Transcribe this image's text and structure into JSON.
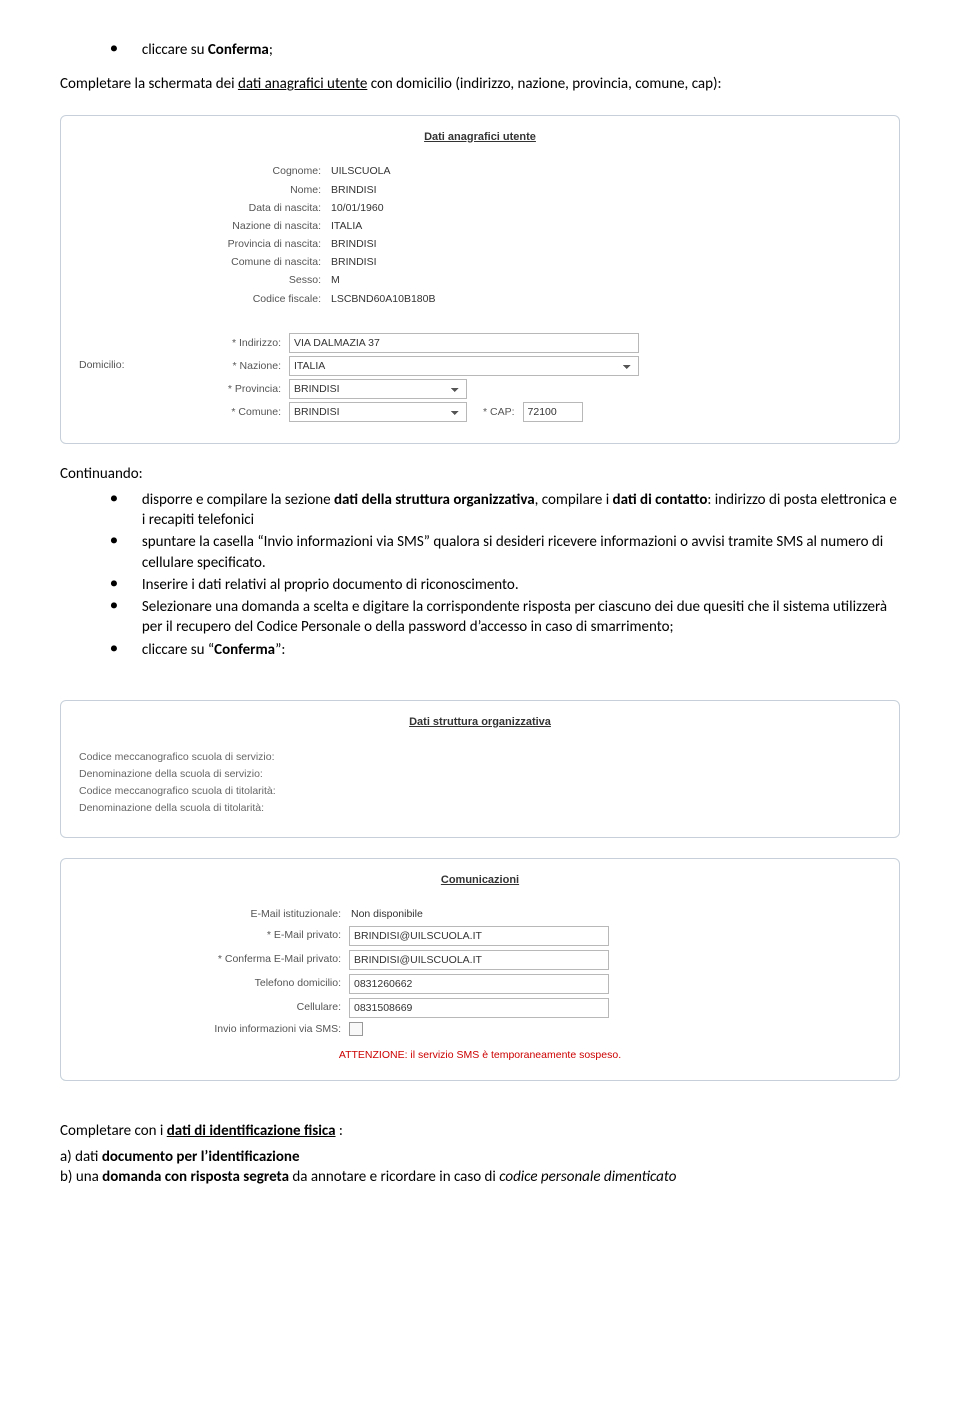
{
  "intro": {
    "bullet1_pre": "cliccare su ",
    "bullet1_bold": "Conferma",
    "bullet1_post": ";",
    "para_pre": "Completare la schermata dei ",
    "para_u": "dati anagrafici utente",
    "para_post": "  con domicilio (indirizzo, nazione, provincia, comune, cap):"
  },
  "panel1": {
    "title": "Dati anagrafici utente",
    "rows": {
      "cognome_l": "Cognome:",
      "cognome_v": "UILSCUOLA",
      "nome_l": "Nome:",
      "nome_v": "BRINDISI",
      "data_l": "Data di nascita:",
      "data_v": "10/01/1960",
      "naz_l": "Nazione di nascita:",
      "naz_v": "ITALIA",
      "prov_l": "Provincia di nascita:",
      "prov_v": "BRINDISI",
      "com_l": "Comune di nascita:",
      "com_v": "BRINDISI",
      "sesso_l": "Sesso:",
      "sesso_v": "M",
      "cf_l": "Codice fiscale:",
      "cf_v": "LSCBND60A10B180B"
    },
    "dom": {
      "side": "Domicilio:",
      "ind_l": "* Indirizzo:",
      "ind_v": "VIA DALMAZIA 37",
      "naz_l": "* Nazione:",
      "naz_v": "ITALIA",
      "prov_l": "* Provincia:",
      "prov_v": "BRINDISI",
      "com_l": "* Comune:",
      "com_v": "BRINDISI",
      "cap_l": "* CAP:",
      "cap_v": "72100"
    }
  },
  "mid": {
    "continuando": "Continuando:",
    "b1_pre": "disporre  e compilare la sezione ",
    "b1_bold1": "dati della struttura organizzativa",
    "b1_mid": ", compilare i ",
    "b1_bold2": "dati di contatto",
    "b1_post": ": indirizzo di posta elettronica e i recapiti telefonici",
    "b2": "spuntare la casella “Invio informazioni via SMS” qualora si desideri ricevere informazioni o avvisi tramite SMS al numero di cellulare specificato.",
    "b3": "Inserire i dati relativi al proprio documento di riconoscimento.",
    "b4": "Selezionare una domanda a scelta e digitare la corrispondente risposta per ciascuno dei due quesiti che il sistema utilizzerà per il recupero del Codice Personale o della password d’accesso in caso di smarrimento;",
    "b5_pre": "cliccare su “",
    "b5_bold": "Conferma",
    "b5_post": "”:"
  },
  "panel2": {
    "title": "Dati struttura organizzativa",
    "l1": "Codice meccanografico scuola di servizio:",
    "l2": "Denominazione della scuola di servizio:",
    "l3": "Codice meccanografico scuola di titolarità:",
    "l4": "Denominazione della scuola di titolarità:"
  },
  "panel3": {
    "title": "Comunicazioni",
    "eist_l": "E-Mail istituzionale:",
    "eist_v": "Non disponibile",
    "epri_l": "* E-Mail privato:",
    "epri_v": "BRINDISI@UILSCUOLA.IT",
    "econ_l": "* Conferma E-Mail privato:",
    "econ_v": "BRINDISI@UILSCUOLA.IT",
    "tel_l": "Telefono domicilio:",
    "tel_v": "0831260662",
    "cel_l": "Cellulare:",
    "cel_v": "0831508669",
    "sms_l": "Invio informazioni via SMS:",
    "attn": "ATTENZIONE: il servizio SMS è temporaneamente sospeso."
  },
  "outro": {
    "p1_pre": "Completare con i ",
    "p1_u": "dati di identificazione fisica",
    "p1_post": " :",
    "p2_pre": "a) dati ",
    "p2_bold": "documento per l’identificazione",
    "p3_pre": "b) una ",
    "p3_bold": "domanda con risposta segreta",
    "p3_mid": " da annotare e ricordare in caso di ",
    "p3_it": "codice personale dimenticato"
  }
}
